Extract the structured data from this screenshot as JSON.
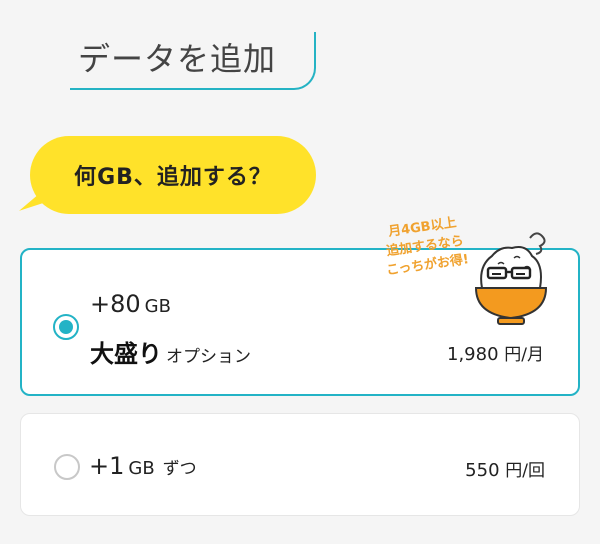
{
  "header": {
    "title": "データを追加"
  },
  "bubble": {
    "text": "何GB、追加する？"
  },
  "options": [
    {
      "amount": "+80",
      "unit": "GB",
      "name": "大盛り",
      "name_suffix": "オプション",
      "price": "1,980",
      "price_unit": "円/月",
      "selected": true,
      "promo_lines": [
        "月4GB以上",
        "追加するなら",
        "こっちがお得!"
      ]
    },
    {
      "amount": "+1",
      "unit": "GB",
      "unit_suffix": "ずつ",
      "price": "550",
      "price_unit": "円/回",
      "selected": false
    }
  ],
  "colors": {
    "accent": "#23b3c6",
    "bubble": "#ffe22a",
    "promo": "#f0a22f",
    "bowl": "#f39a1f"
  },
  "mascot_icon": "rice-bowl-mascot-icon"
}
